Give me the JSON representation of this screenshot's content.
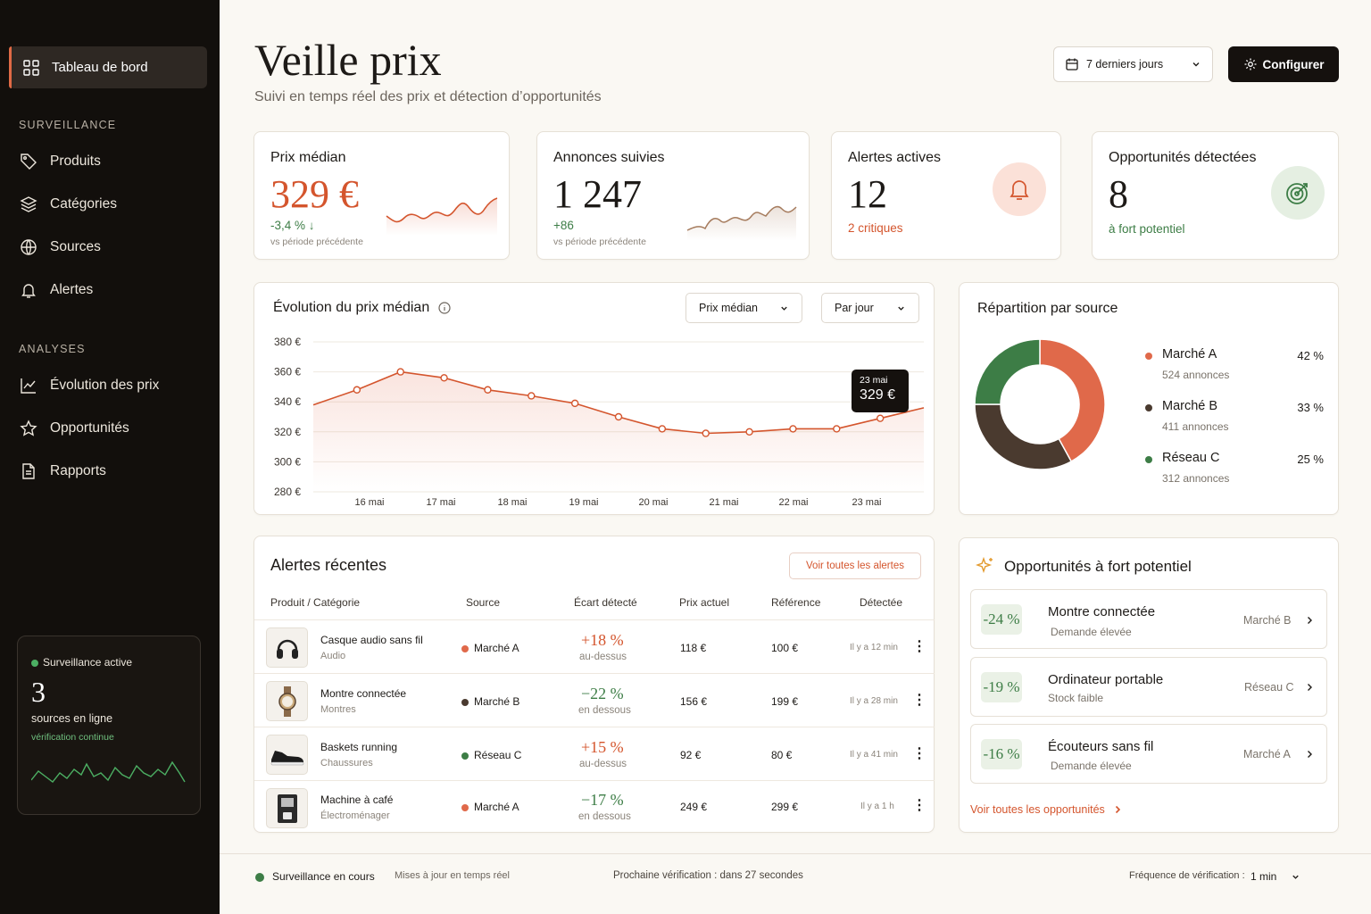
{
  "sidebar": {
    "active": "Tableau de bord",
    "section1": "SURVEILLANCE",
    "items1": [
      "Produits",
      "Catégories",
      "Sources",
      "Alertes"
    ],
    "section2": "ANALYSES",
    "items2": [
      "Évolution des prix",
      "Opportunités",
      "Rapports"
    ],
    "status": {
      "label": "Surveillance active",
      "count": "3",
      "sub": "sources en ligne",
      "note": "vérification continue"
    }
  },
  "header": {
    "title": "Veille prix",
    "subtitle": "Suivi en temps réel des prix et détection d’opportunités",
    "range": "7 derniers jours",
    "config": "Configurer"
  },
  "kpis": {
    "median": {
      "label": "Prix médian",
      "value": "329 €",
      "delta": "-3,4 % ↓",
      "note": "vs période précédente"
    },
    "ads": {
      "label": "Annonces suivies",
      "value": "1 247",
      "delta": "+86",
      "note": "vs période précédente"
    },
    "alerts": {
      "label": "Alertes actives",
      "value": "12",
      "sub": "2 critiques"
    },
    "opps": {
      "label": "Opportunités détectées",
      "value": "8",
      "sub": "à fort potentiel"
    }
  },
  "evolution": {
    "title": "Évolution du prix médian",
    "select1": "Prix médian",
    "select2": "Par jour",
    "tooltip": {
      "date": "23 mai",
      "value": "329 €"
    }
  },
  "chart_data": {
    "type": "line",
    "yticks": [
      "380 €",
      "360 €",
      "340 €",
      "320 €",
      "300 €",
      "280 €"
    ],
    "xticks": [
      "16 mai",
      "17 mai",
      "18 mai",
      "19 mai",
      "20 mai",
      "21 mai",
      "22 mai",
      "23 mai"
    ],
    "ylim": [
      280,
      380
    ],
    "points": [
      [
        0,
        338
      ],
      [
        1,
        348
      ],
      [
        2,
        360
      ],
      [
        3,
        356
      ],
      [
        4,
        348
      ],
      [
        5,
        344
      ],
      [
        6,
        339
      ],
      [
        7,
        330
      ],
      [
        8,
        322
      ],
      [
        9,
        319
      ],
      [
        10,
        320
      ],
      [
        11,
        322
      ],
      [
        12,
        322
      ],
      [
        13,
        329
      ],
      [
        14,
        336
      ]
    ],
    "grid": true
  },
  "distribution": {
    "title": "Répartition par source",
    "sources": [
      {
        "name": "Marché A",
        "count": "524 annonces",
        "pct": "42 %",
        "value": 42,
        "color": "#e0694a"
      },
      {
        "name": "Marché B",
        "count": "411 annonces",
        "pct": "33 %",
        "value": 33,
        "color": "#4a3a2f"
      },
      {
        "name": "Réseau C",
        "count": "312 annonces",
        "pct": "25 %",
        "value": 25,
        "color": "#3d7d46"
      }
    ]
  },
  "alerts": {
    "title": "Alertes récentes",
    "link": "Voir toutes les alertes",
    "headers": [
      "Produit / Catégorie",
      "Source",
      "Écart détecté",
      "Prix actuel",
      "Référence",
      "Détectée"
    ],
    "rows": [
      {
        "name": "Casque audio sans fil",
        "cat": "Audio",
        "source": "Marché A",
        "scolor": "#e0694a",
        "gap": "+18 %",
        "gapnote": "au-dessus",
        "price": "118 €",
        "ref": "100 €",
        "time": "Il y a 12 min"
      },
      {
        "name": "Montre connectée",
        "cat": "Montres",
        "source": "Marché B",
        "scolor": "#4a3a2f",
        "gap": "−22 %",
        "gapnote": "en dessous",
        "price": "156 €",
        "ref": "199 €",
        "time": "Il y a 28 min"
      },
      {
        "name": "Baskets running",
        "cat": "Chaussures",
        "source": "Réseau C",
        "scolor": "#3d7d46",
        "gap": "+15 %",
        "gapnote": "au-dessus",
        "price": "92 €",
        "ref": "80 €",
        "time": "Il y a 41 min"
      },
      {
        "name": "Machine à café",
        "cat": "Électroménager",
        "source": "Marché A",
        "scolor": "#e0694a",
        "gap": "−17 %",
        "gapnote": "en dessous",
        "price": "249 €",
        "ref": "299 €",
        "time": "Il y a 1 h"
      }
    ]
  },
  "opportunities": {
    "title": "Opportunités à fort potentiel",
    "link": "Voir toutes les opportunités",
    "items": [
      {
        "pct": "-24 %",
        "name": "Montre connectée",
        "sub": "Demande élevée",
        "source": "Marché B"
      },
      {
        "pct": "-19 %",
        "name": "Ordinateur portable",
        "sub": "Stock faible",
        "source": "Réseau C"
      },
      {
        "pct": "-16 %",
        "name": "Écouteurs sans fil",
        "sub": "Demande élevée",
        "source": "Marché A"
      }
    ]
  },
  "footer": {
    "status": "Surveillance en cours",
    "live": "Mises à jour en temps réel",
    "next": "Prochaine vérification :  dans 27 secondes",
    "freq_label": "Fréquence de vérification :",
    "freq": "1 min"
  }
}
